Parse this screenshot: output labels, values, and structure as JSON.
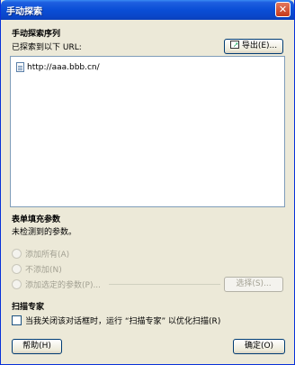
{
  "window": {
    "title": "手动探索"
  },
  "sequence": {
    "heading": "手动探索序列",
    "explored_label": "已探索到以下 URL:",
    "export_label": "导出(E)...",
    "urls": [
      "http://aaa.bbb.cn/"
    ]
  },
  "form": {
    "heading": "表单填充参数",
    "status": "未检测到的参数。",
    "options": [
      "添加所有(A)",
      "不添加(N)",
      "添加选定的参数(P)..."
    ],
    "select_label": "选择(S)..."
  },
  "scan_expert": {
    "heading": "扫描专家",
    "checkbox_label": "当我关闭该对话框时，运行 “扫描专家” 以优化扫描(R)"
  },
  "footer": {
    "help_label": "帮助(H)",
    "ok_label": "确定(O)"
  }
}
